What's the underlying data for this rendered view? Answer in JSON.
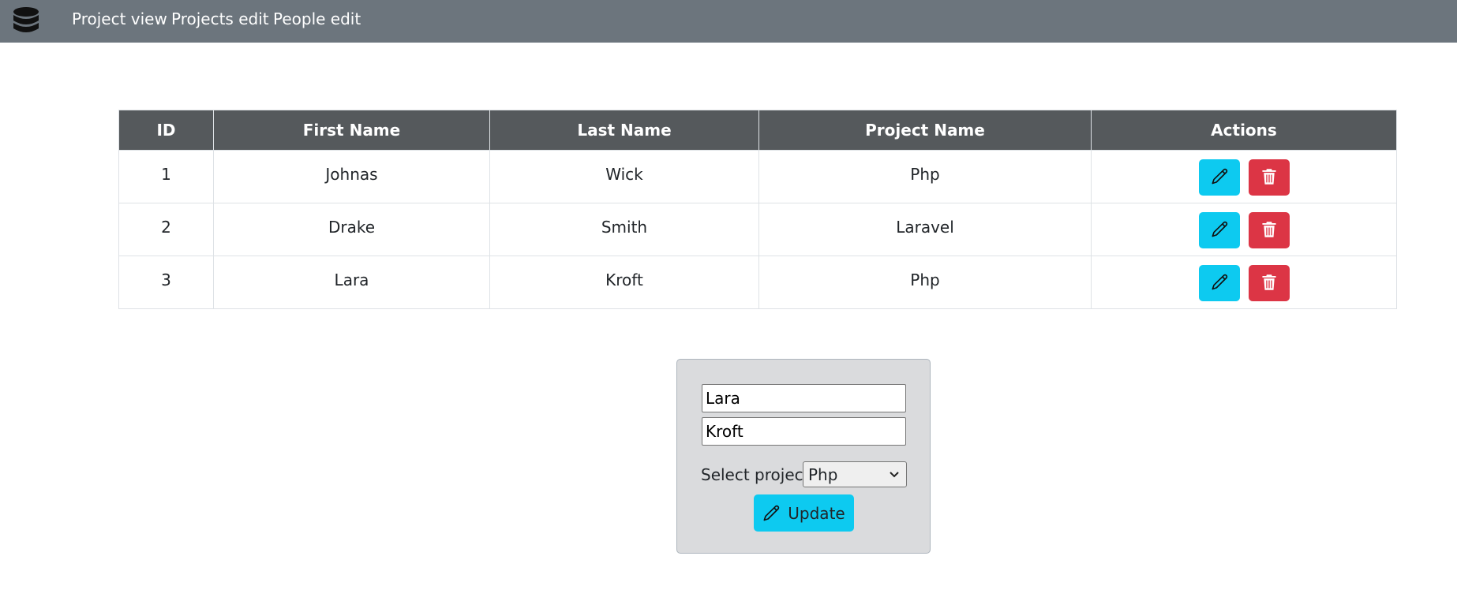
{
  "navbar": {
    "brand_icon": "database-icon",
    "links": [
      {
        "label": "Project view"
      },
      {
        "label": "Projects edit"
      },
      {
        "label": "People edit"
      }
    ]
  },
  "table": {
    "headers": [
      "ID",
      "First Name",
      "Last Name",
      "Project Name",
      "Actions"
    ],
    "rows": [
      {
        "id": "1",
        "first_name": "Johnas",
        "last_name": "Wick",
        "project": "Php"
      },
      {
        "id": "2",
        "first_name": "Drake",
        "last_name": "Smith",
        "project": "Laravel"
      },
      {
        "id": "3",
        "first_name": "Lara",
        "last_name": "Kroft",
        "project": "Php"
      }
    ],
    "edit_icon": "pencil-icon",
    "delete_icon": "trash-icon"
  },
  "form": {
    "first_name_value": "Lara",
    "last_name_value": "Kroft",
    "select_label": "Select project:",
    "select_value": "Php",
    "update_label": "Update"
  },
  "colors": {
    "navbar": "#6c757d",
    "table_header": "#55595c",
    "edit_button": "#0dcaf0",
    "delete_button": "#dc3545",
    "form_background": "#dadbdd"
  }
}
